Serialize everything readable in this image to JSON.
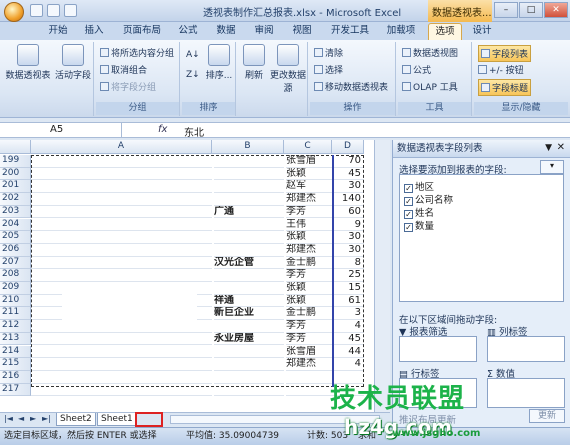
{
  "window": {
    "title": "透视表制作汇总报表.xlsx - Microsoft Excel",
    "context_tab": "数据透视表..."
  },
  "tabs": [
    "开始",
    "插入",
    "页面布局",
    "公式",
    "数据",
    "审阅",
    "视图",
    "开发工具",
    "加载项",
    "选项",
    "设计"
  ],
  "active_tab": "选项",
  "ribbon": {
    "groups": [
      "分组",
      "排序",
      "操作",
      "工具",
      "显示/隐藏"
    ],
    "pivot_table": "数据透视表",
    "active_field": "活动字段",
    "group_selection": "将所选内容分组",
    "ungroup": "取消组合",
    "group_field": "将字段分组",
    "sort": "排序...",
    "refresh": "刷新",
    "change_source": "更改数据源",
    "clear": "清除",
    "select": "选择",
    "move_pivot": "移动数据透视表",
    "pivot_chart": "数据透视图",
    "formula": "公式",
    "olap": "OLAP 工具",
    "field_list": "字段列表",
    "buttons": "+/- 按钮",
    "field_headers": "字段标题"
  },
  "formula_bar": {
    "name_box": "A5",
    "fx": "fx",
    "value": "东北"
  },
  "columns": [
    "A",
    "B",
    "C",
    "D"
  ],
  "rows": [
    {
      "n": "199",
      "b": "",
      "c": "张雪眉",
      "d": "70"
    },
    {
      "n": "200",
      "b": "",
      "c": "张颖",
      "d": "45"
    },
    {
      "n": "201",
      "b": "",
      "c": "赵军",
      "d": "30"
    },
    {
      "n": "202",
      "b": "",
      "c": "郑建杰",
      "d": "140"
    },
    {
      "n": "203",
      "b": "广通",
      "c": "李芳",
      "d": "60"
    },
    {
      "n": "204",
      "b": "",
      "c": "王伟",
      "d": "9"
    },
    {
      "n": "205",
      "b": "",
      "c": "张颖",
      "d": "30"
    },
    {
      "n": "206",
      "b": "",
      "c": "郑建杰",
      "d": "30"
    },
    {
      "n": "207",
      "b": "汉光企管",
      "c": "金士鹏",
      "d": "8"
    },
    {
      "n": "208",
      "b": "",
      "c": "李芳",
      "d": "25"
    },
    {
      "n": "209",
      "b": "",
      "c": "张颖",
      "d": "15"
    },
    {
      "n": "210",
      "b": "祥通",
      "c": "张颖",
      "d": "61"
    },
    {
      "n": "211",
      "b": "新巨企业",
      "c": "金士鹏",
      "d": "3"
    },
    {
      "n": "212",
      "b": "",
      "c": "李芳",
      "d": "4"
    },
    {
      "n": "213",
      "b": "永业房屋",
      "c": "李芳",
      "d": "45"
    },
    {
      "n": "214",
      "b": "",
      "c": "张雪眉",
      "d": "44"
    },
    {
      "n": "215",
      "b": "",
      "c": "郑建杰",
      "d": "4"
    },
    {
      "n": "216",
      "b": "",
      "c": "",
      "d": ""
    },
    {
      "n": "217",
      "b": "",
      "c": "",
      "d": ""
    }
  ],
  "sheet_tabs": [
    "Sheet2",
    "Sheet1"
  ],
  "status": {
    "text": "选定目标区域，然后按 ENTER 或选择",
    "avg": "平均值: 35.09004739",
    "count": "计数: 503",
    "sum": "求和"
  },
  "panel": {
    "title": "数据透视表字段列表",
    "choose_label": "选择要添加到报表的字段:",
    "fields": [
      "地区",
      "公司名称",
      "姓名",
      "数量"
    ],
    "drag_label": "在以下区域间拖动字段:",
    "report_filter": "报表筛选",
    "col_label": "列标签",
    "row_label": "行标签",
    "values": "数值",
    "defer": "推迟布局更新",
    "update": "更新"
  },
  "watermark": {
    "big": "技术员联盟",
    "url": "hz4g.com",
    "small": "www.jsgho.com"
  }
}
